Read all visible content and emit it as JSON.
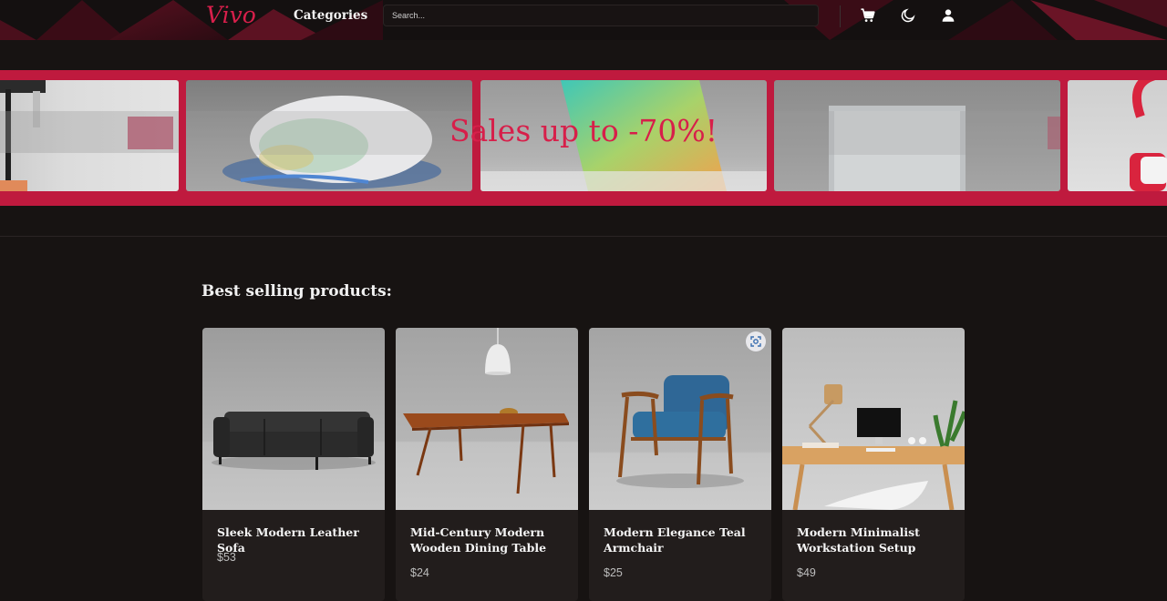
{
  "header": {
    "logo": "Vivo",
    "categories_label": "Categories",
    "search_placeholder": "Search...",
    "icons": [
      "cart-icon",
      "moon-icon",
      "user-icon"
    ]
  },
  "banner": {
    "text": "Sales up to -70%!"
  },
  "products": {
    "title": "Best selling products:",
    "items": [
      {
        "name": "Sleek Modern Leather Sofa",
        "price": "$53"
      },
      {
        "name": "Mid-Century Modern Wooden Dining Table",
        "price": "$24"
      },
      {
        "name": "Modern Elegance Teal Armchair",
        "price": "$25"
      },
      {
        "name": "Modern Minimalist Workstation Setup",
        "price": "$49"
      }
    ]
  },
  "colors": {
    "accent": "#d81f4b",
    "banner_bg": "#bf1a3e",
    "page_bg": "#171312",
    "card_bg": "#221d1c"
  }
}
